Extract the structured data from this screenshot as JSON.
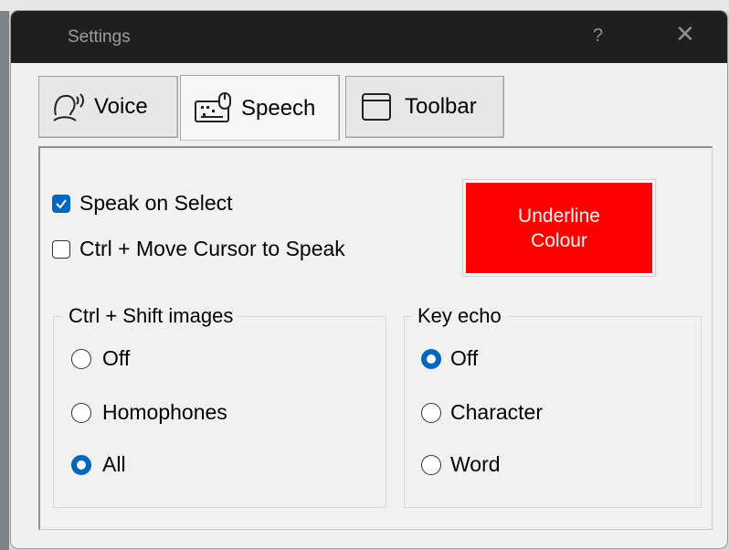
{
  "window": {
    "title": "Settings",
    "help_glyph": "?",
    "close_glyph": "✕"
  },
  "tabs": [
    {
      "label": "Voice",
      "icon": "voice-head-icon",
      "selected": false
    },
    {
      "label": "Speech",
      "icon": "keyboard-mouse-icon",
      "selected": true
    },
    {
      "label": "Toolbar",
      "icon": "window-frame-icon",
      "selected": false
    }
  ],
  "speech": {
    "speak_on_select": {
      "label": "Speak on Select",
      "checked": true
    },
    "ctrl_move": {
      "label": "Ctrl + Move Cursor to Speak",
      "checked": false
    },
    "underline_button": {
      "label": "Underline Colour",
      "color": "#ff0000"
    },
    "ctrl_shift_images": {
      "legend": "Ctrl + Shift images",
      "options": [
        {
          "label": "Off",
          "selected": false
        },
        {
          "label": "Homophones",
          "selected": false
        },
        {
          "label": "All",
          "selected": true
        }
      ]
    },
    "key_echo": {
      "legend": "Key echo",
      "options": [
        {
          "label": "Off",
          "selected": true
        },
        {
          "label": "Character",
          "selected": false
        },
        {
          "label": "Word",
          "selected": false
        }
      ]
    }
  },
  "colors": {
    "accent": "#0067c0",
    "titlebar": "#1f1f1f",
    "dialog_bg": "#f0f0f0"
  }
}
